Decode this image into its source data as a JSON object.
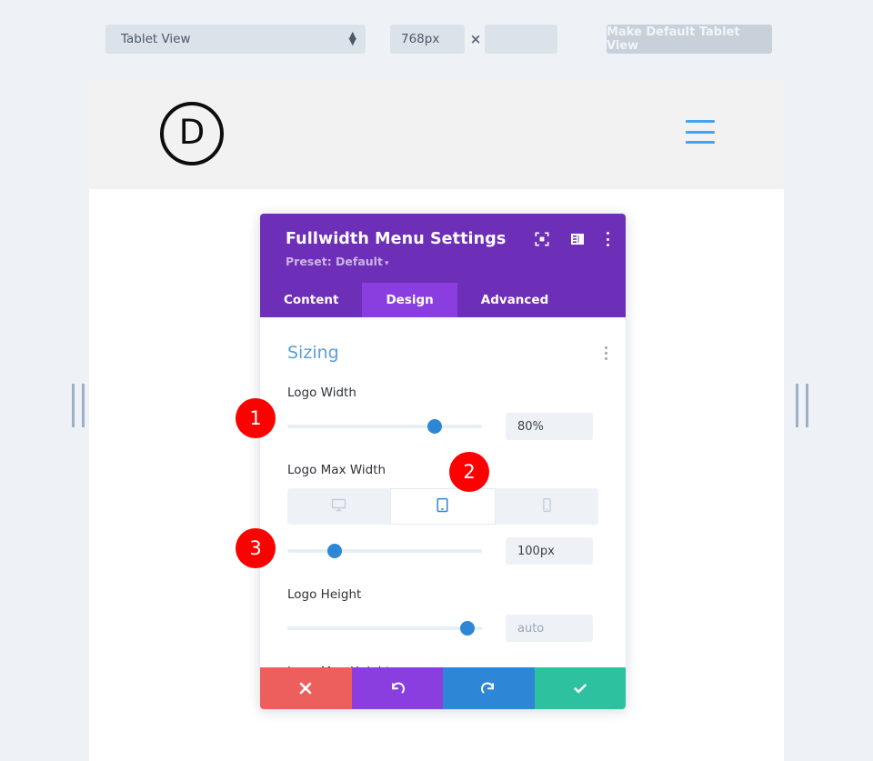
{
  "toolbar": {
    "view_select_value": "Tablet View",
    "spinner_icon": "spinner-up-down-icon",
    "width_value": "768px",
    "separator": "×",
    "height_value": "",
    "make_default_label": "Make Default Tablet View"
  },
  "preview": {
    "logo_letter": "D",
    "logo_icon": "divi-circle-d-logo",
    "menu_icon": "hamburger-menu-icon",
    "left_grip_icon": "resize-grip-icon",
    "right_grip_icon": "resize-grip-icon",
    "scrollbar_icon": "page-scrollbar-thumb"
  },
  "modal": {
    "title": "Fullwidth Menu Settings",
    "preset_label": "Preset: Default",
    "preset_caret": "▾",
    "head_icons": [
      {
        "name": "focus-target-icon"
      },
      {
        "name": "layout-panel-icon"
      },
      {
        "name": "more-options-icon"
      }
    ],
    "tabs": [
      {
        "label": "Content",
        "active": false
      },
      {
        "label": "Design",
        "active": true
      },
      {
        "label": "Advanced",
        "active": false
      }
    ],
    "section": {
      "title": "Sizing",
      "options_icon": "section-more-options-icon"
    },
    "fields": [
      {
        "label": "Logo Width",
        "value": "80%",
        "slider_percent": 78,
        "is_placeholder": false
      },
      {
        "label": "Logo Max Width",
        "value": "100px",
        "slider_percent": 22,
        "is_placeholder": false,
        "device_tabs": [
          {
            "name": "desktop",
            "icon": "desktop-icon",
            "active": false
          },
          {
            "name": "tablet",
            "icon": "tablet-icon",
            "active": true
          },
          {
            "name": "phone",
            "icon": "phone-icon",
            "active": false
          }
        ]
      },
      {
        "label": "Logo Height",
        "value": "auto",
        "slider_percent": 96,
        "is_placeholder": true
      },
      {
        "label": "Logo Max Height",
        "value": "",
        "slider_percent": 0,
        "is_placeholder": true
      }
    ],
    "footer_buttons": [
      {
        "name": "cancel-button",
        "icon": "close-x-icon",
        "color": "#ec5f5d"
      },
      {
        "name": "undo-button",
        "icon": "undo-arrow-icon",
        "color": "#8b3ee0"
      },
      {
        "name": "redo-button",
        "icon": "redo-arrow-icon",
        "color": "#2e87d6"
      },
      {
        "name": "save-button",
        "icon": "checkmark-icon",
        "color": "#2ec1a0"
      }
    ]
  },
  "annotations": [
    {
      "number": "1",
      "target": "logo-width-slider"
    },
    {
      "number": "2",
      "target": "logo-max-width-tablet-tab"
    },
    {
      "number": "3",
      "target": "logo-max-width-slider"
    }
  ],
  "colors": {
    "page_background": "#eef2f7",
    "modal_header": "#6d2eb8",
    "active_tab": "#8b3ee0",
    "accent_blue": "#2e87d6",
    "section_title": "#5b9dd9",
    "badge_red": "#fd0000"
  }
}
